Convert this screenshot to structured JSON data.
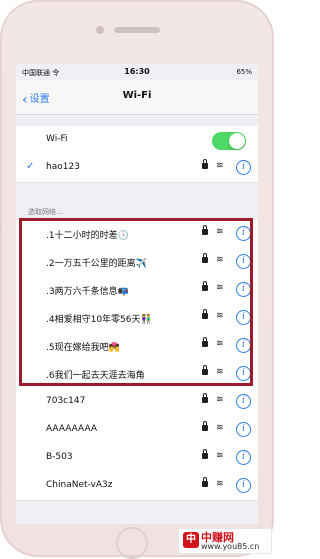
{
  "status_bar": {
    "carrier": "中国联通 令",
    "time": "16:30",
    "battery": "65%"
  },
  "nav": {
    "back_label": "设置",
    "title": "Wi-Fi"
  },
  "wifi_toggle": {
    "label": "Wi-Fi",
    "on": true
  },
  "connected": {
    "name": "hao123"
  },
  "section_header": "选取网络...",
  "networks": [
    {
      "name": ".1十二小时的时差🕓"
    },
    {
      "name": ".2一万五千公里的距离✈️"
    },
    {
      "name": ".3两万六千条信息📭"
    },
    {
      "name": ".4相爱相守10年零56天👫"
    },
    {
      "name": ".5现在嫁给我吧💏"
    },
    {
      "name": ".6我们一起去天涯去海角"
    },
    {
      "name": "703c147"
    },
    {
      "name": "AAAAAAAA"
    },
    {
      "name": "B-503"
    },
    {
      "name": "ChinaNet-vA3z"
    }
  ],
  "icons": {
    "info": "i",
    "wifi": "📶"
  },
  "watermark": {
    "brand": "中赚网",
    "url": "www.you85.cn"
  },
  "colors": {
    "accent": "#2b7de9",
    "toggle_on": "#4cd964",
    "highlight_border": "#9b1b2a"
  }
}
